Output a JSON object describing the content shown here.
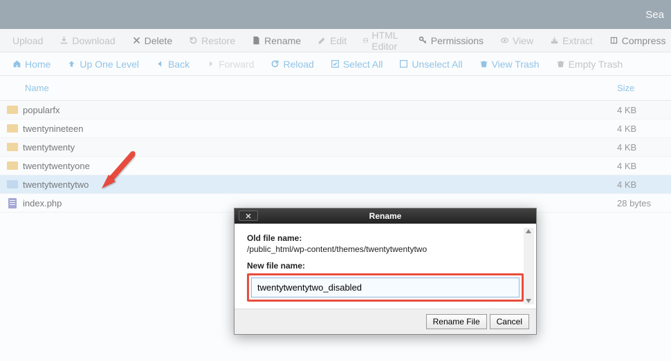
{
  "topbar": {
    "search": "Sea"
  },
  "toolbar1": {
    "upload": "Upload",
    "download": "Download",
    "delete": "Delete",
    "restore": "Restore",
    "rename": "Rename",
    "edit": "Edit",
    "html_editor": "HTML Editor",
    "permissions": "Permissions",
    "view": "View",
    "extract": "Extract",
    "compress": "Compress"
  },
  "toolbar2": {
    "home": "Home",
    "up": "Up One Level",
    "back": "Back",
    "forward": "Forward",
    "reload": "Reload",
    "select_all": "Select All",
    "unselect_all": "Unselect All",
    "view_trash": "View Trash",
    "empty_trash": "Empty Trash"
  },
  "table": {
    "headers": {
      "name": "Name",
      "size": "Size"
    },
    "rows": [
      {
        "type": "folder",
        "name": "popularfx",
        "size": "4 KB"
      },
      {
        "type": "folder",
        "name": "twentynineteen",
        "size": "4 KB"
      },
      {
        "type": "folder",
        "name": "twentytwenty",
        "size": "4 KB"
      },
      {
        "type": "folder",
        "name": "twentytwentyone",
        "size": "4 KB"
      },
      {
        "type": "folder",
        "name": "twentytwentytwo",
        "size": "4 KB",
        "selected": true
      },
      {
        "type": "file",
        "name": "index.php",
        "size": "28 bytes"
      }
    ]
  },
  "modal": {
    "title": "Rename",
    "old_label": "Old file name:",
    "old_path": "/public_html/wp-content/themes/twentytwentytwo",
    "new_label": "New file name:",
    "new_value": "twentytwentytwo_disabled",
    "rename_btn": "Rename File",
    "cancel_btn": "Cancel"
  }
}
